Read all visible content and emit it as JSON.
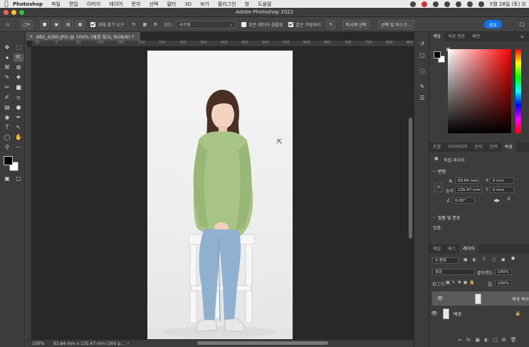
{
  "menubar": {
    "app": "Photoshop",
    "items": [
      "파일",
      "편집",
      "이미지",
      "레이어",
      "문자",
      "선택",
      "필터",
      "3D",
      "보기",
      "플러그인",
      "창",
      "도움말"
    ],
    "datetime": "5월 28일 (토) 오"
  },
  "window": {
    "title": "Adobe Photoshop 2022"
  },
  "options": {
    "auto_select": "개체 찾기 도구",
    "mode_label": "모드:",
    "mode_value": "사각형",
    "all_layers": "모든 레이어 샘플링",
    "hard_edge": "굵은 가장자리",
    "select_subject": "피사체 선택",
    "select_mask": "선택 및 마스크...",
    "share": "공유"
  },
  "document": {
    "tab": "IMG_4280.JPG @ 100% (배경 복사, RGB/8) *",
    "zoom": "100%",
    "size": "63.84 mm x 135.47 mm (300 p..."
  },
  "ruler_ticks": [
    "50",
    "0",
    "50",
    "100",
    "150",
    "200",
    "250",
    "300",
    "350",
    "400",
    "450",
    "500",
    "550",
    "600",
    "650",
    "700",
    "750",
    "800",
    "850"
  ],
  "color_panel": {
    "tabs": [
      "색상",
      "색상 견본",
      "패턴"
    ]
  },
  "props_panel": {
    "tabs": [
      "조정",
      "라이브러리",
      "문자",
      "단락",
      "속성"
    ],
    "layer_type": "픽셀 레이어",
    "transform": "변형",
    "w_label": "폭",
    "w": "63.84 mm",
    "h_label": "높이",
    "h": "135.47 mm",
    "x_label": "X",
    "x": "0 mm",
    "y_label": "Y",
    "y": "0 mm",
    "angle": "0.00°",
    "align_dist": "맞춤 및 분포",
    "align": "맞춤:"
  },
  "layers_panel": {
    "tabs": [
      "채널",
      "패스",
      "레이어"
    ],
    "filter": "종류",
    "blend": "표준",
    "opacity_label": "불투명도:",
    "opacity": "100%",
    "lock_label": "잠그기:",
    "fill_label": "칠:",
    "fill": "100%",
    "layers": [
      {
        "name": "배경 복사",
        "selected": true
      },
      {
        "name": "배경",
        "selected": false,
        "locked": true
      }
    ]
  }
}
